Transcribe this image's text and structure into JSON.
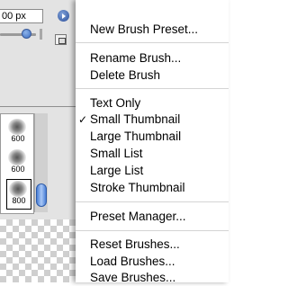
{
  "panel": {
    "size_value": "00 px",
    "brushes": [
      {
        "size": "600"
      },
      {
        "size": "600"
      },
      {
        "size": "800"
      }
    ]
  },
  "menu": {
    "items": [
      {
        "label": "New Brush Preset...",
        "checked": false
      },
      {
        "label": "Rename Brush...",
        "checked": false
      },
      {
        "label": "Delete Brush",
        "checked": false
      },
      {
        "label": "Text Only",
        "checked": false
      },
      {
        "label": "Small Thumbnail",
        "checked": true
      },
      {
        "label": "Large Thumbnail",
        "checked": false
      },
      {
        "label": "Small List",
        "checked": false
      },
      {
        "label": "Large List",
        "checked": false
      },
      {
        "label": "Stroke Thumbnail",
        "checked": false
      },
      {
        "label": "Preset Manager...",
        "checked": false
      },
      {
        "label": "Reset Brushes...",
        "checked": false
      },
      {
        "label": "Load Brushes...",
        "checked": false
      },
      {
        "label": "Save Brushes...",
        "checked": false
      }
    ],
    "check_glyph": "✓"
  },
  "icons": {
    "menu_arrow": "right-triangle-icon",
    "new_preset": "new-preset-icon",
    "check": "checkmark-icon"
  },
  "colors": {
    "accent_blue": "#3a6cc0"
  }
}
